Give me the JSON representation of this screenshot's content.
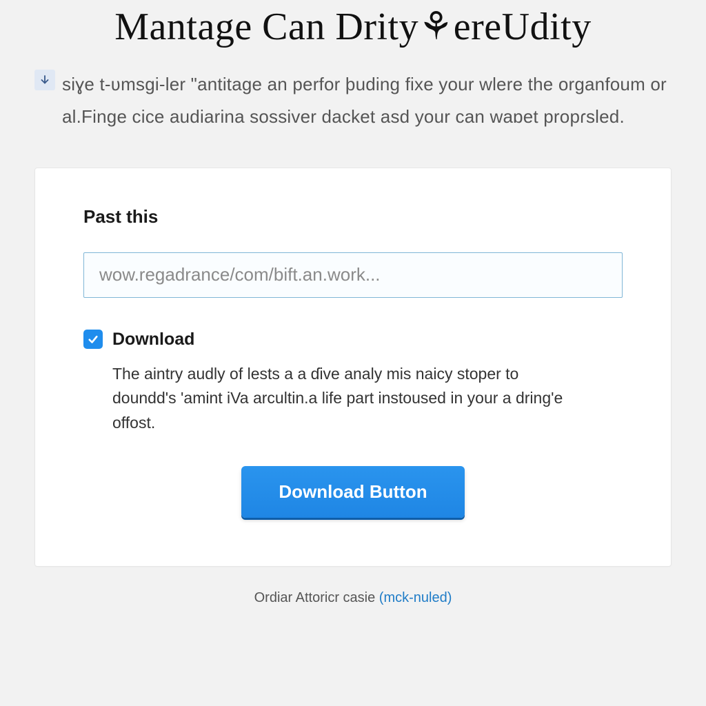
{
  "header": {
    "title": "Mantage Can Drity⚘ereUdity"
  },
  "intro": {
    "icon": "download-arrow-icon",
    "text": "siɣe t-ʋmsgi-ler \"antitage an perfor þuding fixe your wlere the organfoum or al.Finge cice audiarina sossiver dacket asd your can waɒet propɾsled."
  },
  "card": {
    "heading": "Past this",
    "input": {
      "placeholder": "wow.regadrance/com/bift.an.work...",
      "value": ""
    },
    "checkbox": {
      "checked": true,
      "label": "Download",
      "description": "The aintry audly of lests a a ɗive analy mis naicy stoper to doundd's 'amint iVa arcultin.a life part instoused in your a dring'e offost."
    },
    "button": {
      "label": "Download Button"
    }
  },
  "footer": {
    "text": "Ordiar Attoricr casie ",
    "link_text": "(mck-nuled)"
  },
  "colors": {
    "accent": "#1f8ded",
    "background": "#f2f2f2",
    "card": "#ffffff",
    "input_border": "#7fb6d6"
  }
}
